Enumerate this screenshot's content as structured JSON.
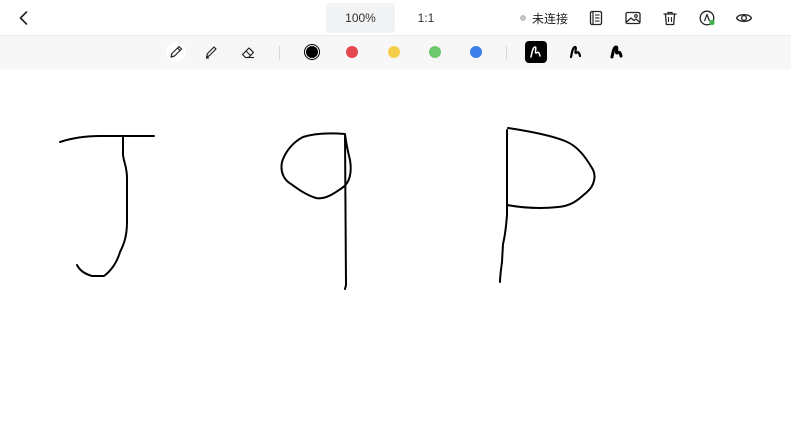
{
  "topbar": {
    "zoom_label": "100%",
    "ratio_label": "1:1",
    "status_text": "未连接",
    "status_color": "#c0c0c0"
  },
  "icons": {
    "back": "chevron-left-icon",
    "notebook": "notebook-icon",
    "image": "image-icon",
    "delete": "trash-icon",
    "sync": "pen-sync-icon",
    "preview": "eye-icon"
  },
  "toolbar": {
    "tools": [
      "pen",
      "highlighter",
      "eraser"
    ],
    "active_tool": "pen",
    "colors": [
      {
        "name": "black",
        "hex": "#000000",
        "selected": true
      },
      {
        "name": "red",
        "hex": "#e5484d",
        "selected": false
      },
      {
        "name": "yellow",
        "hex": "#f5cf4a",
        "selected": false
      },
      {
        "name": "green",
        "hex": "#6cc96c",
        "selected": false
      },
      {
        "name": "blue",
        "hex": "#3b7de9",
        "selected": false
      }
    ],
    "stroke_widths": [
      "thin",
      "medium",
      "thick"
    ],
    "active_stroke": "thin"
  },
  "canvas": {
    "stroke_color": "#000000"
  }
}
